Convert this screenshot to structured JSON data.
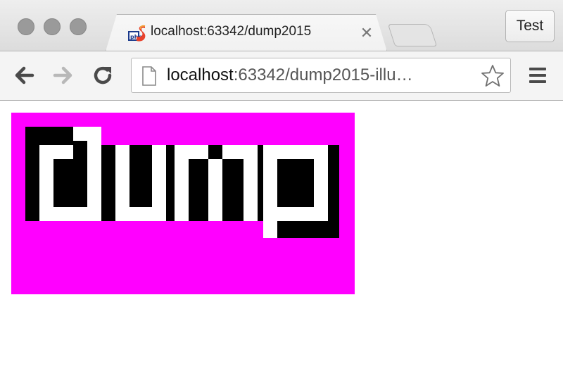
{
  "window": {
    "tab": {
      "title": "localhost:63342/dump2015",
      "favicon": "phpstorm-icon",
      "close_icon": "close-icon"
    },
    "profile_button": "Test"
  },
  "toolbar": {
    "back_icon": "back-arrow-icon",
    "forward_icon": "forward-arrow-icon",
    "reload_icon": "reload-icon",
    "address": {
      "host": "localhost",
      "rest": ":63342/dump2015-illu…",
      "page_icon": "page-icon",
      "bookmark_icon": "star-icon"
    },
    "menu_icon": "hamburger-menu-icon"
  },
  "page": {
    "logo": {
      "text": "dump",
      "background": "#ff00ff",
      "letter_color": "#ffffff",
      "shadow_color": "#000000"
    }
  }
}
